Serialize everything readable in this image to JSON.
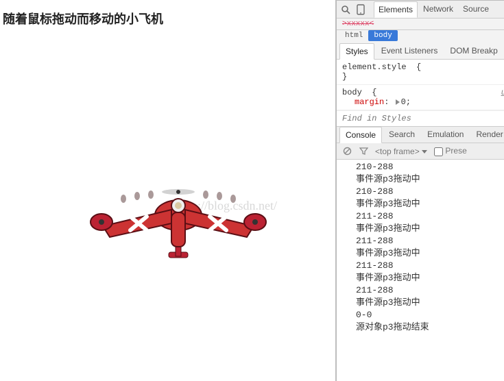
{
  "page": {
    "title": "随着鼠标拖动而移动的小飞机",
    "watermark": "http://blog.csdn.net/"
  },
  "toolbar": {
    "tabs": [
      "Elements",
      "Network",
      "Source"
    ],
    "active_index": 0
  },
  "dom": {
    "struck": ">xxxxx<",
    "crumbs": [
      "html",
      "body"
    ],
    "selected_index": 1
  },
  "styles_tabs": {
    "items": [
      "Styles",
      "Event Listeners",
      "DOM Breakp"
    ],
    "active_index": 0
  },
  "styles": {
    "element_style_selector": "element.style",
    "brace_open": "{",
    "brace_close": "}",
    "body_selector": "body",
    "body_origin": "u",
    "margin_prop": "margin",
    "margin_val": "0",
    "colon": ":",
    "semicolon": ";"
  },
  "find_placeholder": "Find in Styles",
  "drawer_tabs": {
    "items": [
      "Console",
      "Search",
      "Emulation",
      "Render"
    ],
    "active_index": 0
  },
  "drawer_bar": {
    "frame_label": "<top frame>",
    "preserve_label": "Prese"
  },
  "console_logs": [
    "210-288",
    "事件源p3拖动中",
    "210-288",
    "事件源p3拖动中",
    "211-288",
    "事件源p3拖动中",
    "211-288",
    "事件源p3拖动中",
    "211-288",
    "事件源p3拖动中",
    "211-288",
    "事件源p3拖动中",
    "0-0",
    "源对象p3拖动结束"
  ]
}
